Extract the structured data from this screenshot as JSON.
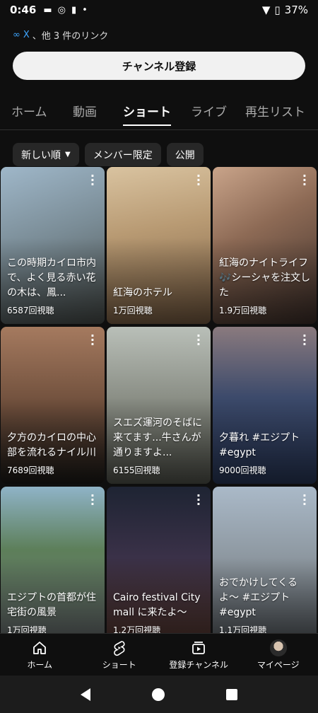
{
  "status": {
    "time": "0:46",
    "battery": "37%"
  },
  "links": {
    "x": "X",
    "rest": "、他 3 件のリンク"
  },
  "subscribe_label": "チャンネル登録",
  "tabs": [
    "ホーム",
    "動画",
    "ショート",
    "ライブ",
    "再生リスト"
  ],
  "chips": {
    "sort": "新しい順",
    "members": "メンバー限定",
    "public": "公開"
  },
  "videos": [
    {
      "title": "この時期カイロ市内で、よく見る赤い花の木は、鳳...",
      "views": "6587回視聴"
    },
    {
      "title": "紅海のホテル",
      "views": "1万回視聴"
    },
    {
      "title": "紅海のナイトライフ🎶シーシャを注文した",
      "views": "1.9万回視聴"
    },
    {
      "title": "夕方のカイロの中心部を流れるナイル川",
      "views": "7689回視聴"
    },
    {
      "title": "スエズ運河のそばに来てます...牛さんが通りますよ...",
      "views": "6155回視聴"
    },
    {
      "title": "夕暮れ #エジプト #egypt",
      "views": "9000回視聴"
    },
    {
      "title": "エジプトの首都が住宅街の風景",
      "views": "1万回視聴"
    },
    {
      "title": "Cairo festival City mall に来たよ〜",
      "views": "1.2万回視聴"
    },
    {
      "title": "おでかけしてくるよ〜 #エジプト #egypt",
      "views": "1.1万回視聴"
    }
  ],
  "bottom_nav": {
    "home": "ホーム",
    "shorts": "ショート",
    "subscriptions": "登録チャンネル",
    "mypage": "マイページ"
  }
}
